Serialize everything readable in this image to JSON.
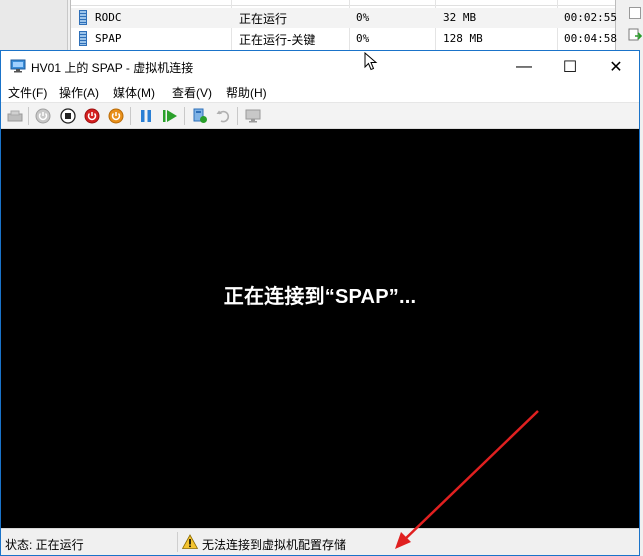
{
  "vm_list": {
    "rows": [
      {
        "name": "RODC",
        "state": "正在运行",
        "cpu": "0%",
        "memory": "32 MB",
        "uptime": "00:02:55"
      },
      {
        "name": "SPAP",
        "state": "正在运行-关键",
        "cpu": "0%",
        "memory": "128 MB",
        "uptime": "00:04:58"
      }
    ]
  },
  "window": {
    "title": "HV01 上的 SPAP - 虚拟机连接",
    "minimize_glyph": "—",
    "maximize_glyph": "☐",
    "close_glyph": "✕"
  },
  "menu": {
    "file": "文件(F)",
    "action": "操作(A)",
    "media": "媒体(M)",
    "view": "查看(V)",
    "help": "帮助(H)"
  },
  "toolbar": {
    "icons": [
      "ctrl-alt-del-icon",
      "start-icon",
      "turn-off-icon",
      "shut-down-icon",
      "save-state-icon",
      "pause-icon",
      "resume-icon",
      "checkpoint-icon",
      "revert-icon",
      "enhanced-session-icon"
    ]
  },
  "screen": {
    "message": "正在连接到“SPAP”..."
  },
  "status": {
    "label": "状态: 正在运行",
    "warning": "无法连接到虚拟机配置存储"
  },
  "colors": {
    "window_border": "#1a73c9",
    "screen_bg": "#000000",
    "annotation_arrow": "#e02020",
    "warning_yellow": "#f4c430"
  }
}
